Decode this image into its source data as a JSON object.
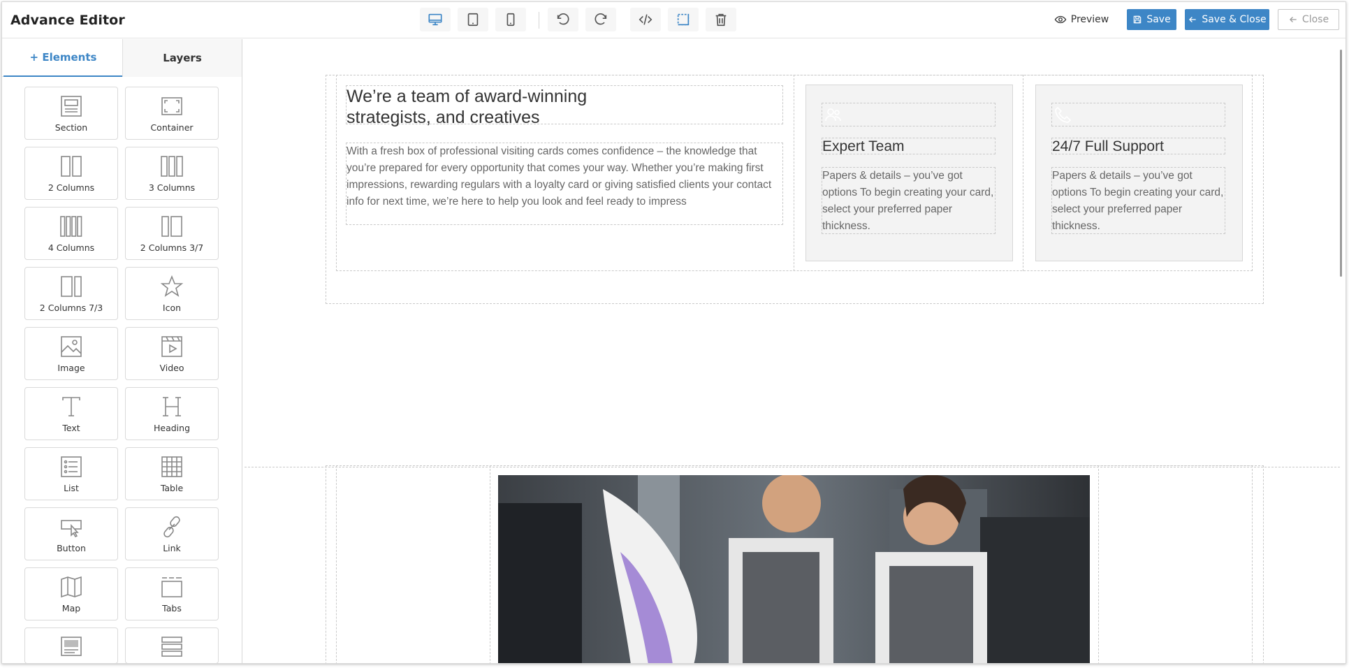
{
  "app": {
    "title": "Advance Editor"
  },
  "toolbar": {
    "device_desktop_icon": "desktop-icon",
    "device_tablet_icon": "tablet-icon",
    "device_mobile_icon": "mobile-icon",
    "undo_icon": "undo-icon",
    "redo_icon": "redo-icon",
    "code_icon": "code-icon",
    "outline_icon": "outline-icon",
    "trash_icon": "trash-icon",
    "active_color": "#3d86c6"
  },
  "actions": {
    "preview_label": "Preview",
    "save_label": "Save",
    "save_close_label": "Save & Close",
    "close_label": "Close",
    "primary_color": "#3d86c6"
  },
  "sidebar": {
    "tabs": [
      {
        "label": "+ Elements",
        "active": true
      },
      {
        "label": "Layers",
        "active": false
      }
    ],
    "elements": [
      {
        "label": "Section",
        "icon": "section-icon"
      },
      {
        "label": "Container",
        "icon": "container-icon"
      },
      {
        "label": "2 Columns",
        "icon": "two-columns-icon"
      },
      {
        "label": "3 Columns",
        "icon": "three-columns-icon"
      },
      {
        "label": "4 Columns",
        "icon": "four-columns-icon"
      },
      {
        "label": "2 Columns 3/7",
        "icon": "two-columns-3-7-icon"
      },
      {
        "label": "2 Columns 7/3",
        "icon": "two-columns-7-3-icon"
      },
      {
        "label": "Icon",
        "icon": "star-icon"
      },
      {
        "label": "Image",
        "icon": "image-icon"
      },
      {
        "label": "Video",
        "icon": "video-icon"
      },
      {
        "label": "Text",
        "icon": "text-icon"
      },
      {
        "label": "Heading",
        "icon": "heading-icon"
      },
      {
        "label": "List",
        "icon": "list-icon"
      },
      {
        "label": "Table",
        "icon": "table-icon"
      },
      {
        "label": "Button",
        "icon": "button-icon"
      },
      {
        "label": "Link",
        "icon": "link-icon"
      },
      {
        "label": "Map",
        "icon": "map-icon"
      },
      {
        "label": "Tabs",
        "icon": "tabs-icon"
      },
      {
        "label": "",
        "icon": "card-icon"
      },
      {
        "label": "",
        "icon": "rows-icon"
      }
    ]
  },
  "canvas": {
    "heading": "We’re a team of award-winning strategists, and creatives",
    "paragraph": "With a fresh box of professional visiting cards comes confidence – the knowledge that you’re prepared for every opportunity that comes your way. Whether you’re making first impressions, rewarding regulars with a loyalty card or giving satisfied clients your contact info for next time, we’re here to help you look and feel ready to impress",
    "cards": [
      {
        "icon": "team-icon",
        "title": "Expert Team",
        "text": "Papers & details – you’ve got options To begin creating your card, select your preferred paper thickness."
      },
      {
        "icon": "phone-icon",
        "title": "24/7 Full Support",
        "text": "Papers & details – you’ve got options To begin creating your card, select your preferred paper thickness."
      }
    ],
    "image_icon": "photo-printing-workers-image"
  }
}
